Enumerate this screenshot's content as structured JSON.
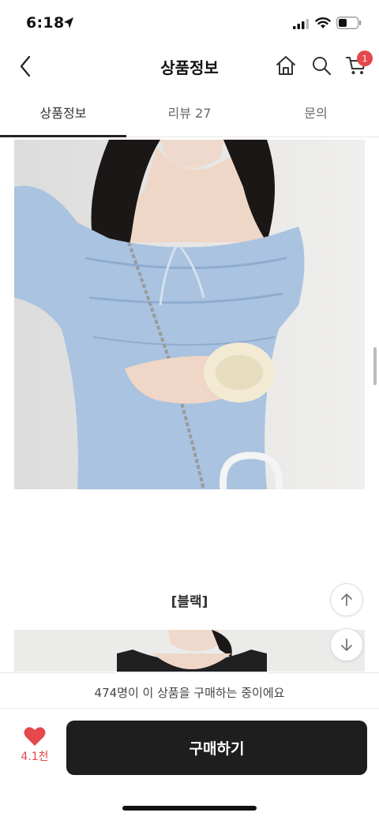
{
  "status_bar": {
    "time": "6:18",
    "icons": [
      "location-arrow-icon",
      "cellular-signal-icon",
      "wifi-icon",
      "battery-icon"
    ]
  },
  "header": {
    "title": "상품정보",
    "back_icon": "chevron-left-icon",
    "home_icon": "home-icon",
    "search_icon": "search-icon",
    "cart_icon": "cart-icon",
    "cart_badge": "1"
  },
  "tabs": [
    {
      "label": "상품정보",
      "active": true
    },
    {
      "label": "리뷰 27",
      "active": false
    },
    {
      "label": "문의",
      "active": false
    }
  ],
  "content": {
    "section_label": "[블랙]"
  },
  "floating": {
    "scroll_up_icon": "arrow-up-icon",
    "scroll_down_icon": "arrow-down-icon"
  },
  "purchase_banner": "474명이 이 상품을 구매하는 중이에요",
  "bottom_bar": {
    "like_count": "4.1천",
    "buy_label": "구매하기"
  },
  "colors": {
    "accent_red": "#e5484d",
    "buy_button": "#1e1e1e",
    "dress_blue": "#a9c3e0"
  }
}
